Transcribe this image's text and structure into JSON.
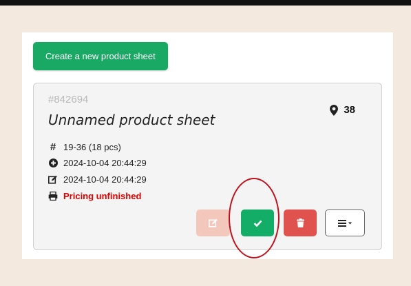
{
  "toolbar": {
    "create_label": "Create a new product sheet"
  },
  "card": {
    "id": "#842694",
    "title": "Unnamed product sheet",
    "location_count": "38",
    "size_range": "19-36 (18 pcs)",
    "created": "2024-10-04 20:44:29",
    "modified": "2024-10-04 20:44:29",
    "status": "Pricing unfinished"
  },
  "icons": {
    "location": "map-marker-icon",
    "size": "hash-icon",
    "created": "plus-circle-icon",
    "modified": "edit-icon",
    "status": "print-icon",
    "edit_button": "edit-icon",
    "check_button": "check-icon",
    "delete_button": "trash-icon",
    "menu_button": "menu-icon"
  },
  "colors": {
    "background": "#f3e9df",
    "primary_green": "#1aa865",
    "danger_red": "#e0524d",
    "edit_disabled": "#f4c7bd",
    "status_red": "#e00000",
    "highlight_circle": "#c0111b"
  }
}
